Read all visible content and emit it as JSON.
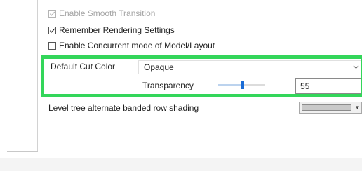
{
  "options": {
    "smooth_transition": {
      "label": "Enable Smooth Transition",
      "checked": true,
      "enabled": false
    },
    "remember_rendering": {
      "label": "Remember Rendering Settings",
      "checked": true,
      "enabled": true
    },
    "concurrent_mode": {
      "label": "Enable Concurrent mode of Model/Layout",
      "checked": false,
      "enabled": true
    }
  },
  "cut_color": {
    "label": "Default Cut Color",
    "selected": "Opaque",
    "transparency_label": "Transparency",
    "transparency_value": "55",
    "slider_fraction": 0.5
  },
  "level_tree": {
    "label": "Level tree alternate banded row shading",
    "swatch_color": "#c9c9c9"
  },
  "colors": {
    "highlight": "#33d65a",
    "accent": "#1a6cd6"
  }
}
